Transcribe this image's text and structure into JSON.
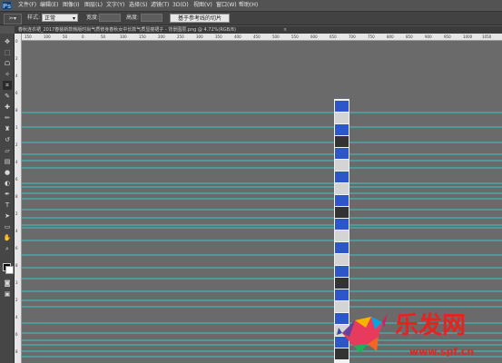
{
  "app": {
    "logo": "Ps"
  },
  "menu": [
    "文件(F)",
    "编辑(E)",
    "图像(I)",
    "图层(L)",
    "文字(Y)",
    "选择(S)",
    "滤镜(T)",
    "3D(D)",
    "视图(V)",
    "窗口(W)",
    "帮助(H)"
  ],
  "options": {
    "tool_icon": "slice-tool-icon",
    "style_label": "样式:",
    "style_value": "正常",
    "width_label": "宽度:",
    "height_label": "高度:",
    "slice_button": "基于参考线的切片"
  },
  "document": {
    "tab_title": "春秋连衣裙_2017春装新款韩版时尚气质修身春秋女中长款气质显瘦裙子 - 背景图层.png @ 4.72%(RGB/8)",
    "close": "×"
  },
  "ruler": {
    "h_labels": [
      "150",
      "100",
      "50",
      "0",
      "50",
      "100",
      "150",
      "200",
      "250",
      "300",
      "350",
      "400",
      "450",
      "500",
      "550",
      "600",
      "650",
      "700",
      "750",
      "800",
      "850",
      "900",
      "950",
      "1000",
      "1050"
    ],
    "v_labels": [
      "0",
      "2",
      "4",
      "6",
      "8",
      "1",
      "2",
      "4",
      "6",
      "8",
      "2",
      "4",
      "6",
      "8",
      "3",
      "2",
      "4",
      "6",
      "8"
    ]
  },
  "colors": {
    "guide": "#39c5c5",
    "canvas": "#6a6a6a",
    "panel": "#535353"
  },
  "watermark": {
    "brand": "乐发网",
    "url": "www.spf.cn"
  }
}
